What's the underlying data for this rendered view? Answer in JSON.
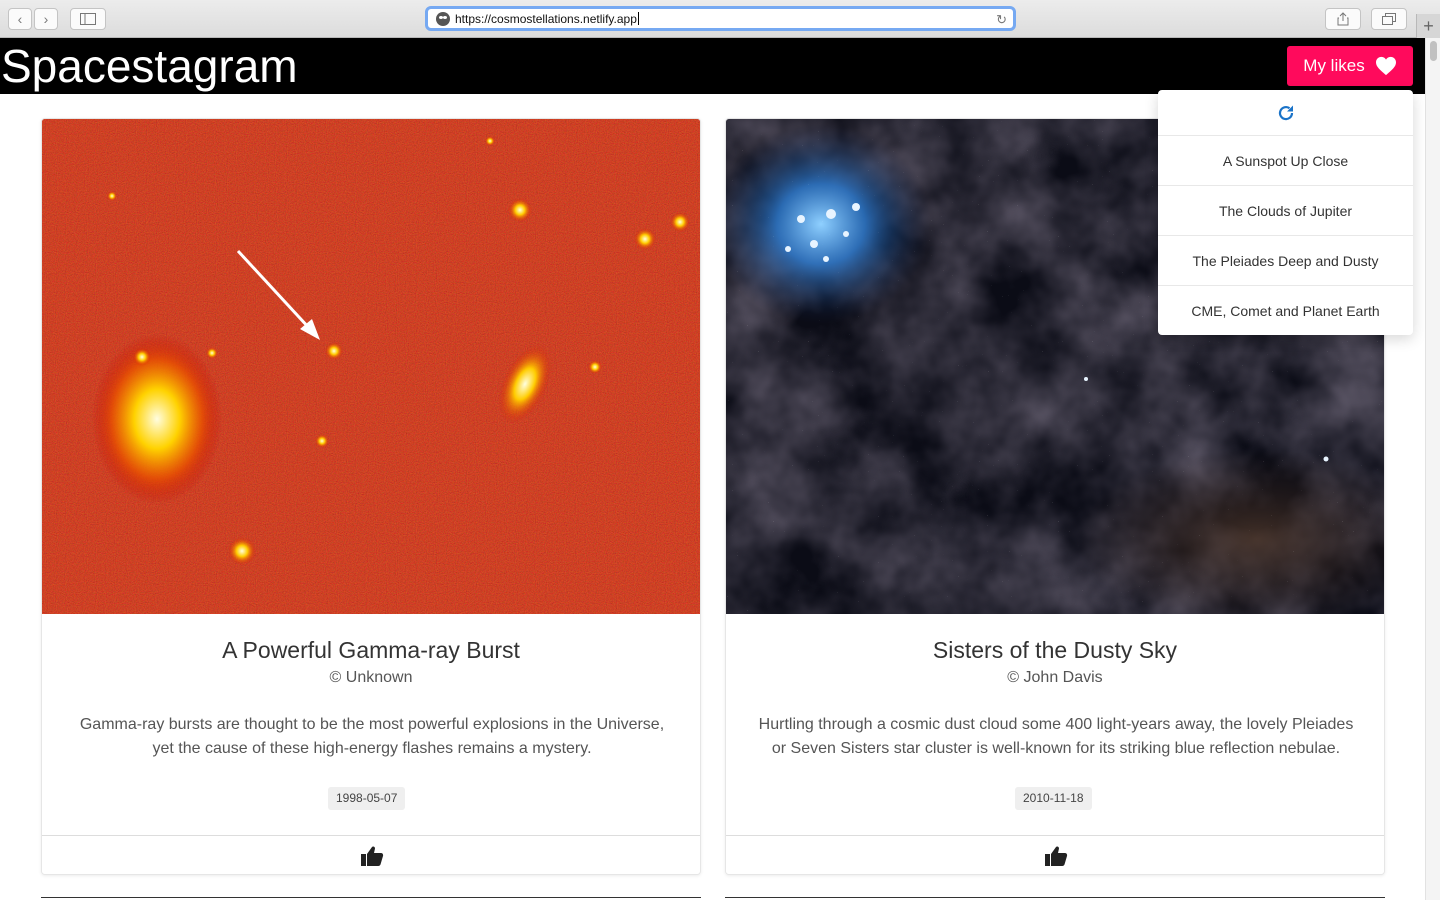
{
  "browser": {
    "url": "https://cosmostellations.netlify.app"
  },
  "header": {
    "brand": "Spacestagram",
    "likes_button": "My likes",
    "likes_color": "#ff0a5c"
  },
  "likes_menu": {
    "refresh_icon": "refresh-icon",
    "items": [
      {
        "label": "A Sunspot Up Close"
      },
      {
        "label": "The Clouds of Jupiter"
      },
      {
        "label": "The Pleiades Deep and Dusty"
      },
      {
        "label": "CME, Comet and Planet Earth"
      }
    ]
  },
  "posts": [
    {
      "title": "A Powerful Gamma-ray Burst",
      "credit": "© Unknown",
      "description": "Gamma-ray bursts are thought to be the most powerful explosions in the Universe, yet the cause of these high-energy flashes remains a mystery.",
      "date": "1998-05-07",
      "like_icon": "thumbs-up-icon"
    },
    {
      "title": "Sisters of the Dusty Sky",
      "credit": "© John Davis",
      "description": "Hurtling through a cosmic dust cloud some 400 light-years away, the lovely Pleiades or Seven Sisters star cluster is well-known for its striking blue reflection nebulae.",
      "date": "2010-11-18",
      "like_icon": "thumbs-up-icon"
    }
  ]
}
